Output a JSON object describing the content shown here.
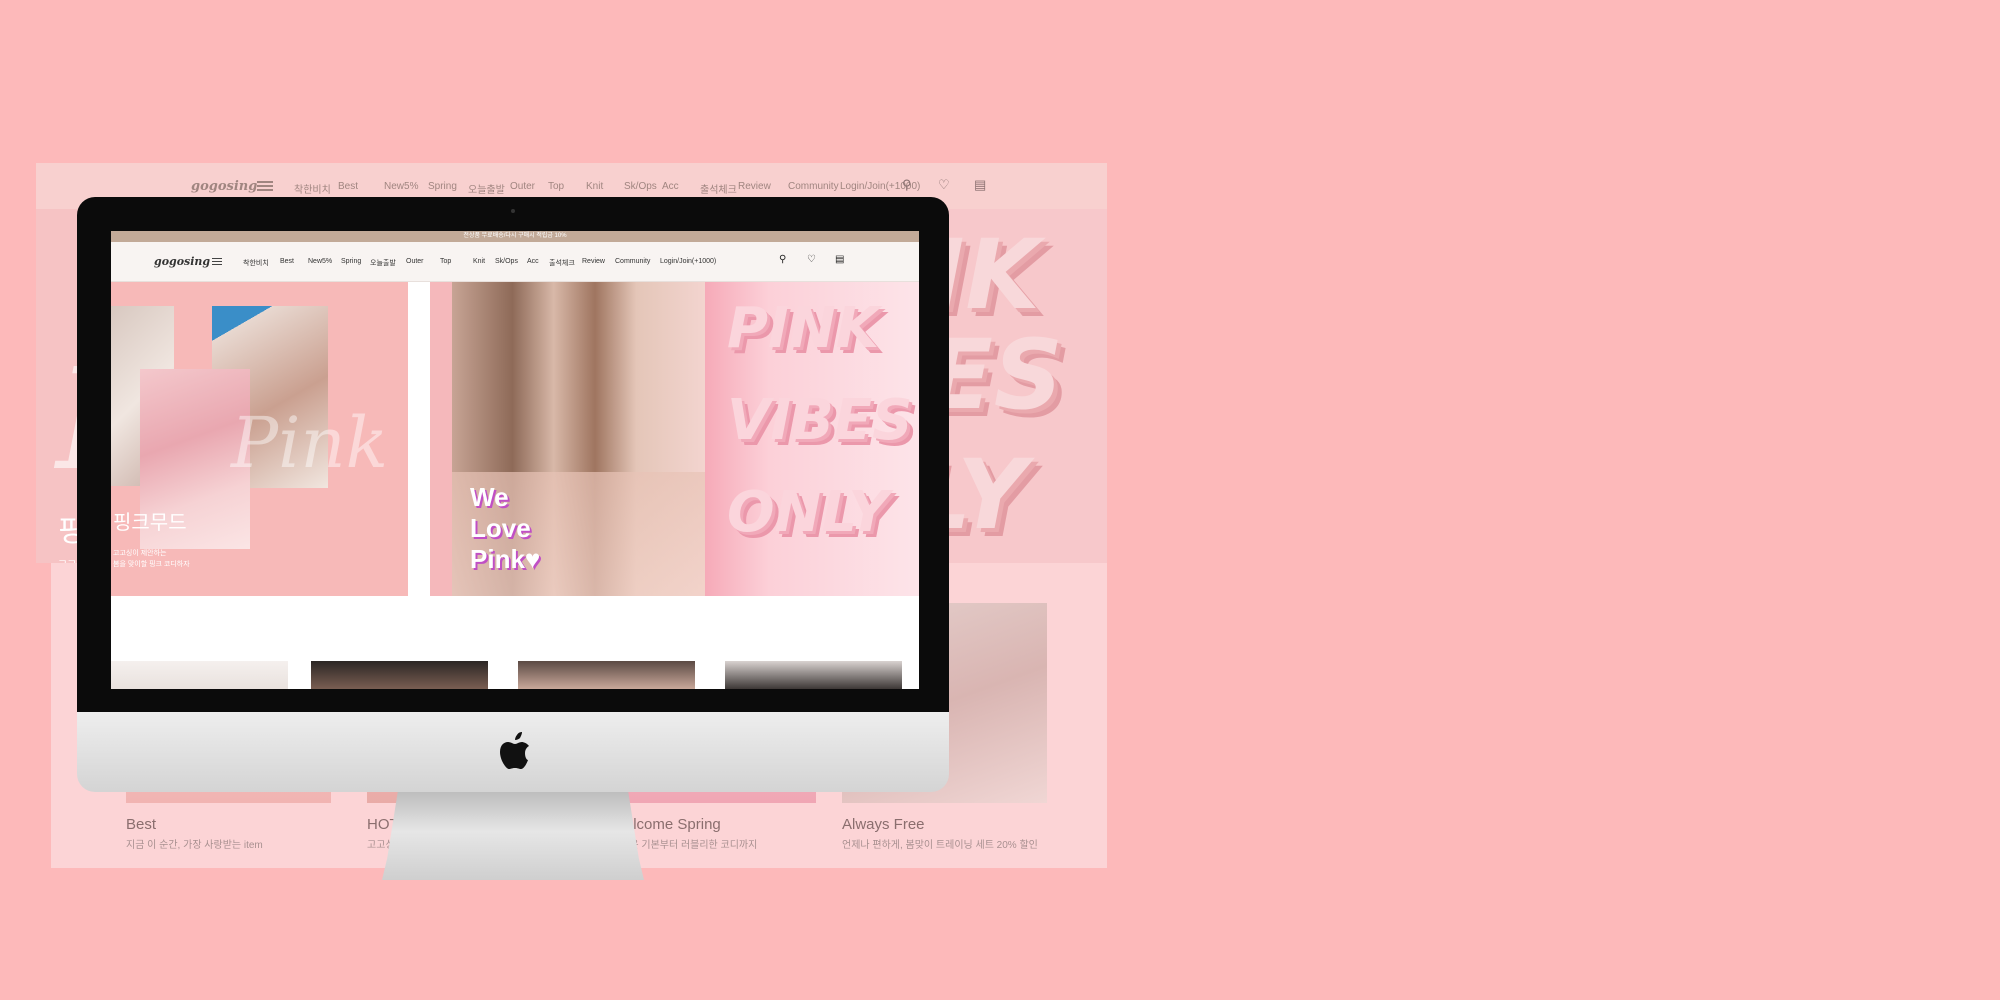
{
  "announcement": "전상품 무료배송/다시 구매시 적립금 10%",
  "site": {
    "logo": "gogosing",
    "nav": [
      "착한비치",
      "Best",
      "New5%",
      "Spring",
      "오늘출발",
      "Outer",
      "Top",
      "Knit",
      "Sk/Ops",
      "Acc",
      "출석체크",
      "Review",
      "Community",
      "Login/Join(+1000)"
    ],
    "icons": [
      "search-icon",
      "heart-icon",
      "bag-icon"
    ]
  },
  "hero": {
    "left_script": "Pink",
    "left_korean_title": "핑크무드",
    "left_korean_sub": [
      "고고싱이 제안하는",
      "봄을 맞이할 핑크 코디하자"
    ],
    "slogan": [
      "We",
      "Love",
      "Pink♥"
    ],
    "right_words": [
      "PINK",
      "VIBES",
      "ONLY"
    ]
  },
  "sections": [
    {
      "title": "Best",
      "subtitle": "지금 이 순간, 가장 사랑받는 item"
    },
    {
      "title": "HOT NEW",
      "subtitle": "고고싱의 신상품"
    },
    {
      "title": "Welcome Spring",
      "subtitle": "가벼운 기본부터 러블리한 코디까지"
    },
    {
      "title": "Always Free",
      "subtitle": "언제나 편하게, 봄맞이 트레이닝 세트 20% 할인"
    }
  ],
  "colors": {
    "background": "#fdb9ba",
    "announcement_bar": "#c2aa98",
    "slogan_shadow": "#c04fc5"
  }
}
